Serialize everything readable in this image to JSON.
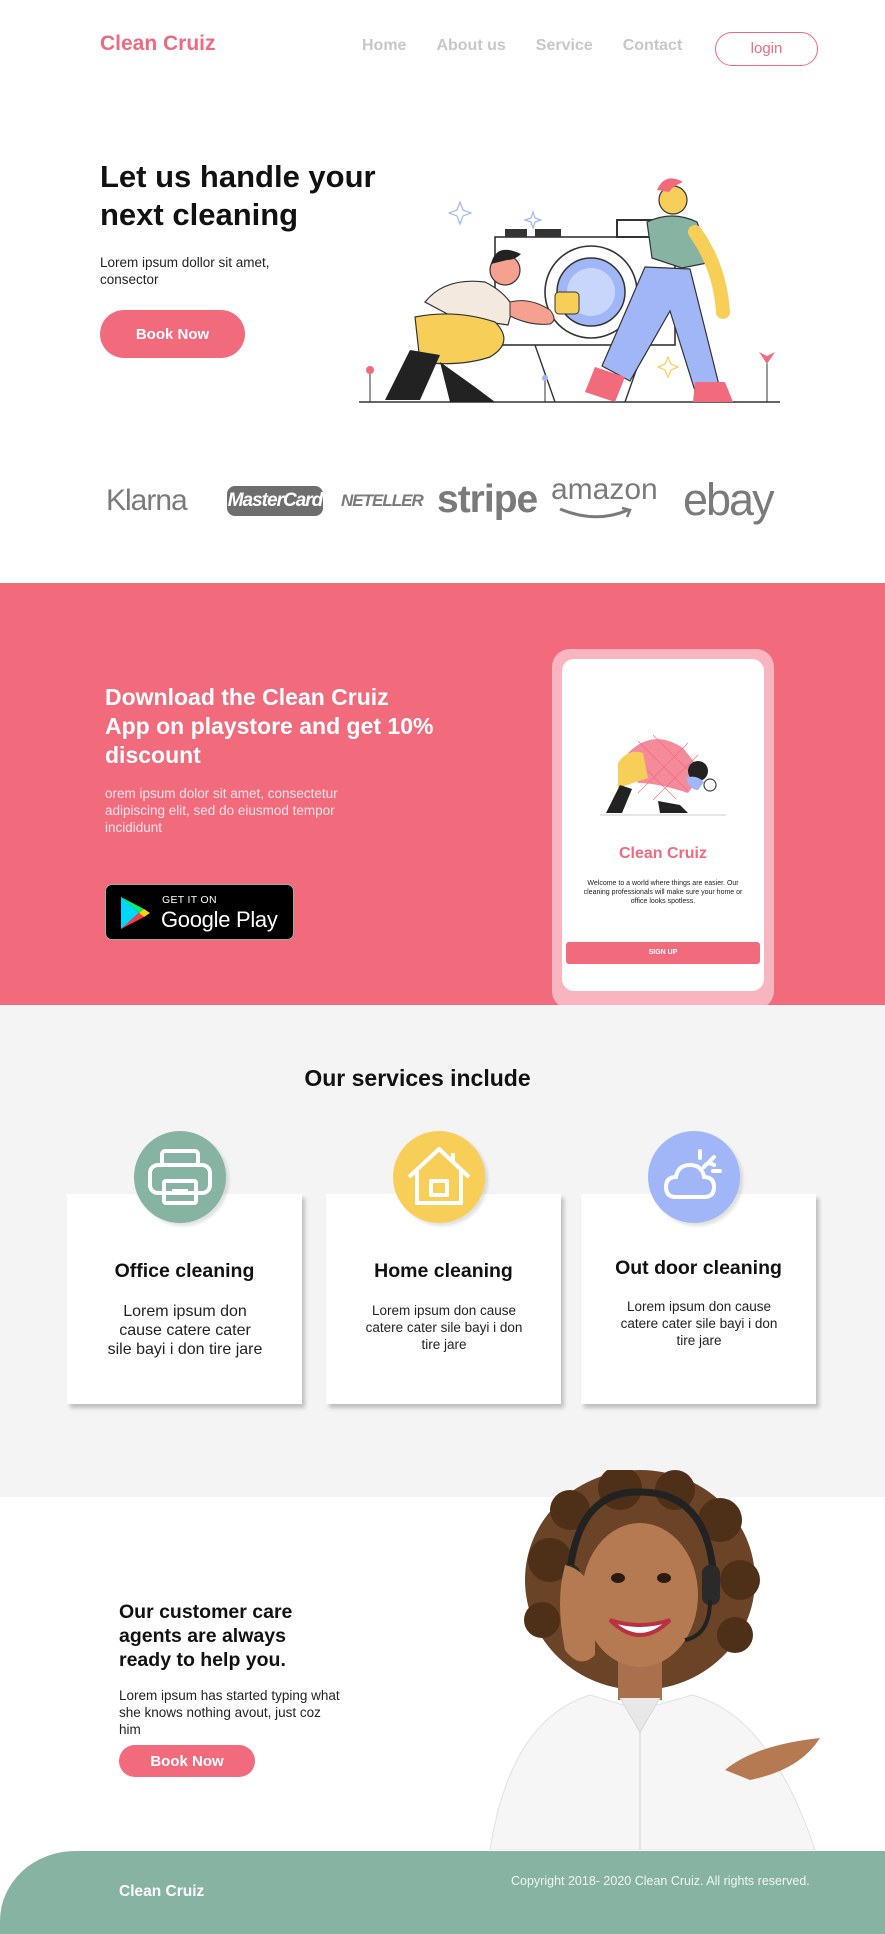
{
  "nav": {
    "logo": "Clean Cruiz",
    "links": [
      "Home",
      "About us",
      "Service",
      "Contact"
    ],
    "login_label": "login"
  },
  "hero": {
    "title": "Let us handle your next cleaning",
    "subtitle": "Lorem ipsum dollor sit amet, consector",
    "cta_label": "Book Now",
    "illustration": "person-cleaning-washing-machine-illustration"
  },
  "partners": [
    "Klarna",
    "MasterCard",
    "NETELLER",
    "stripe",
    "amazon",
    "ebay"
  ],
  "promo": {
    "title": "Download the Clean Cruiz App on playstore and get 10% discount",
    "subtitle": "orem ipsum dolor sit amet, consectetur adipiscing elit, sed do eiusmod tempor incididunt",
    "store_badge": {
      "small": "GET IT ON",
      "big": "Google Play"
    },
    "phone": {
      "brand": "Clean Cruiz",
      "text": "Welcome to a world where things are easier. Our cleaning professionals will make sure your home or office looks spotless.",
      "signup_label": "SIGN UP"
    }
  },
  "services": {
    "title": "Our services include",
    "items": [
      {
        "title": "Office cleaning",
        "desc": "Lorem ipsum don cause catere cater sile bayi i don tire jare",
        "icon": "printer-icon",
        "color": "#86b3a2"
      },
      {
        "title": "Home cleaning",
        "desc": "Lorem ipsum don cause catere cater sile bayi i don tire jare",
        "icon": "house-icon",
        "color": "#f7cf58"
      },
      {
        "title": "Out door cleaning",
        "desc": "Lorem ipsum don cause catere cater sile bayi i don tire jare",
        "icon": "cloud-sun-icon",
        "color": "#a0b6f7"
      }
    ]
  },
  "care": {
    "title": "Our customer care agents are always ready to help you.",
    "subtitle": "Lorem ipsum has started typing what she knows nothing avout, just coz him",
    "cta_label": "Book Now",
    "photo": "customer-care-agent-photo"
  },
  "footer": {
    "brand": "Clean Cruiz",
    "copyright": "Copyright 2018- 2020 Clean Cruiz. All rights reserved."
  },
  "colors": {
    "accent": "#f16b7d",
    "green": "#86b3a2",
    "yellow": "#f7cf58",
    "blue": "#a0b6f7",
    "light_bg": "#f4f4f4"
  }
}
